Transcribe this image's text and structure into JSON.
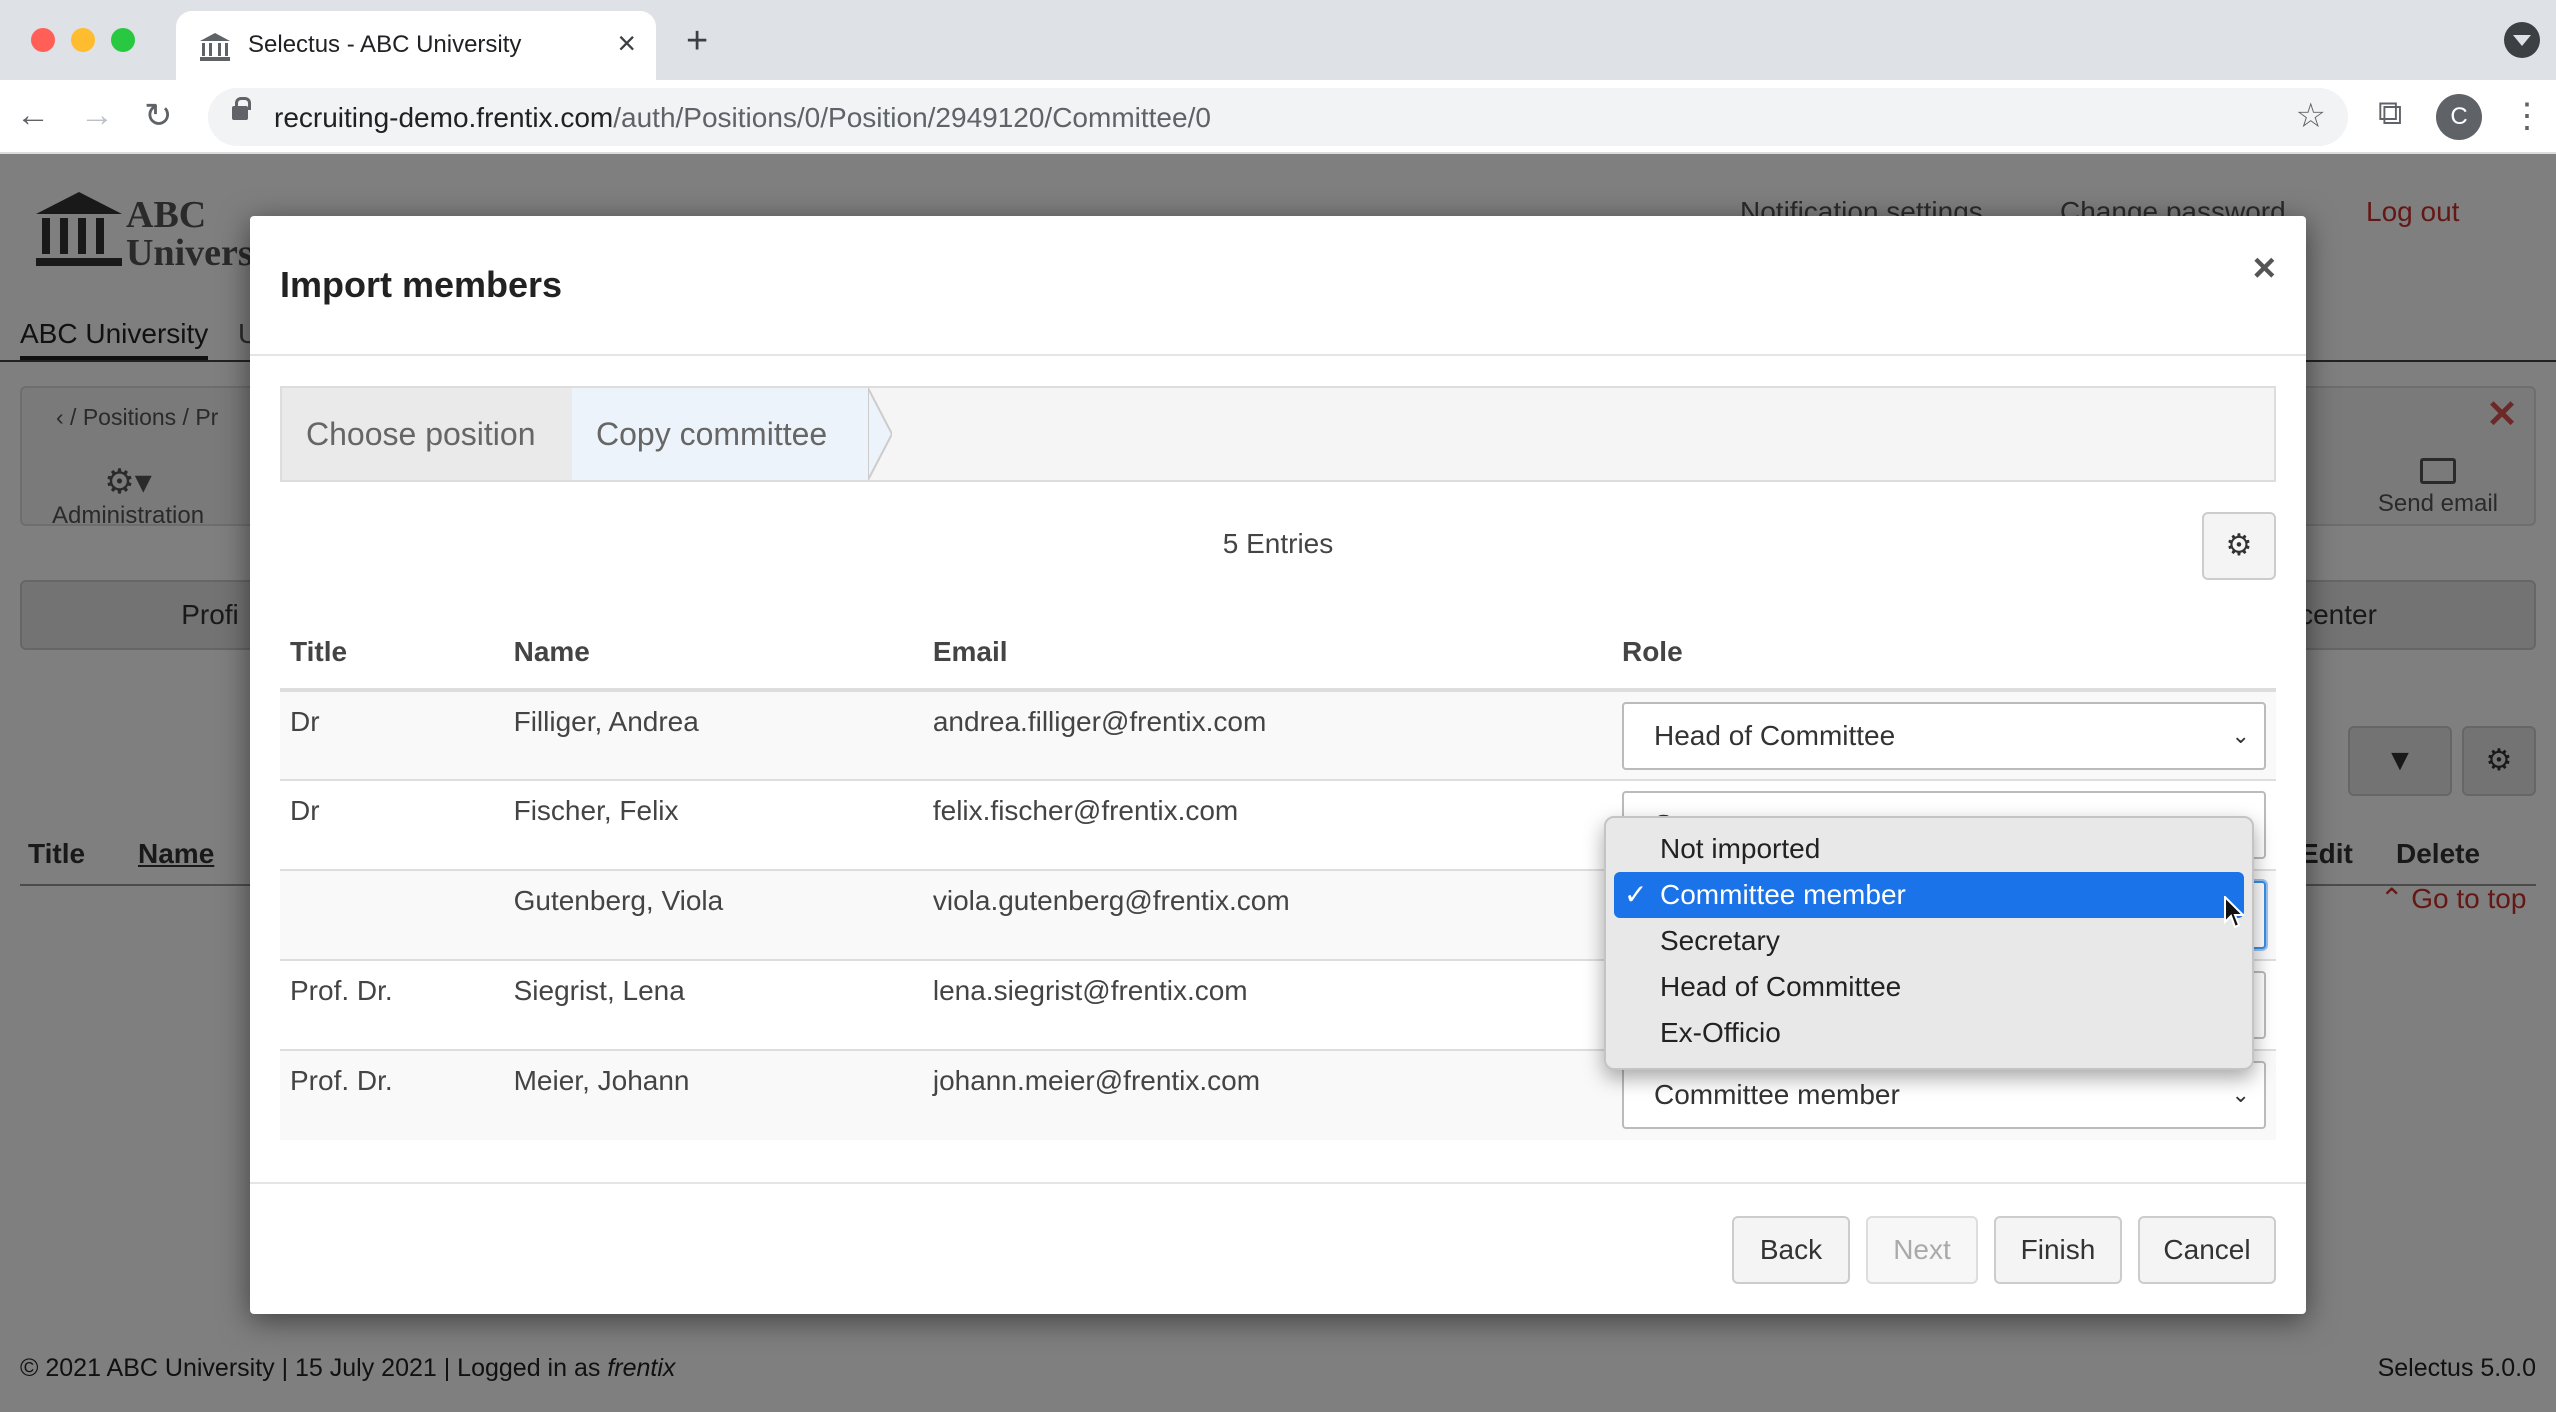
{
  "browser": {
    "tab_title": "Selectus - ABC University",
    "tab_close": "×",
    "new_tab": "+",
    "url_host": "recruiting-demo.frentix.com",
    "url_path": "/auth/Positions/0/Position/2949120/Committee/0",
    "profile_initial": "C",
    "back": "←",
    "forward": "→",
    "reload": "↻",
    "star": "☆",
    "extensions": "⧉",
    "kebab": "⋮"
  },
  "page": {
    "logo_line1": "ABC",
    "logo_line2": "Universit",
    "notification_settings": "Notification settings",
    "change_password": "Change password",
    "logout": "Log out",
    "nav_tab": "ABC University",
    "nav_tab2": "U",
    "breadcrumb": "‹   /   Positions   /   Pr",
    "breadcrumb_close": "✕",
    "administration": "Administration",
    "send_email": "Send email",
    "partial_s": "s",
    "btn_profile": "Profi",
    "btn_center": "center",
    "filter_icon": "▼",
    "gear_icon": "⚙",
    "col_title": "Title",
    "col_name": "Name",
    "col_edit": "Edit",
    "col_delete": "Delete",
    "go_to_top": "⌃ Go to top",
    "footer_text": "© 2021 ABC University | 15 July 2021 | Logged in as ",
    "footer_user": "frentix",
    "version": "Selectus 5.0.0"
  },
  "modal": {
    "title": "Import members",
    "close": "×",
    "steps": [
      "Choose position",
      "Copy committee"
    ],
    "entries": "5 Entries",
    "settings_icon": "⚙",
    "columns": [
      "Title",
      "Name",
      "Email",
      "Role"
    ],
    "rows": [
      {
        "title": "Dr",
        "name": "Filliger, Andrea",
        "email": "andrea.filliger@frentix.com",
        "role": "Head of Committee"
      },
      {
        "title": "Dr",
        "name": "Fischer, Felix",
        "email": "felix.fischer@frentix.com",
        "role": "Secretary"
      },
      {
        "title": "",
        "name": "Gutenberg, Viola",
        "email": "viola.gutenberg@frentix.com",
        "role": "Committee member"
      },
      {
        "title": "Prof. Dr.",
        "name": "Siegrist, Lena",
        "email": "lena.siegrist@frentix.com",
        "role": "Committee member"
      },
      {
        "title": "Prof. Dr.",
        "name": "Meier, Johann",
        "email": "johann.meier@frentix.com",
        "role": "Committee member"
      }
    ],
    "buttons": {
      "back": "Back",
      "next": "Next",
      "finish": "Finish",
      "cancel": "Cancel"
    }
  },
  "dropdown": {
    "options": [
      "Not imported",
      "Committee member",
      "Secretary",
      "Head of Committee",
      "Ex-Officio"
    ],
    "selected_index": 1,
    "check": "✓"
  },
  "colors": {
    "accent": "#1a73e8",
    "danger": "#c9302c",
    "backdrop": "rgba(0,0,0,0.5)"
  }
}
